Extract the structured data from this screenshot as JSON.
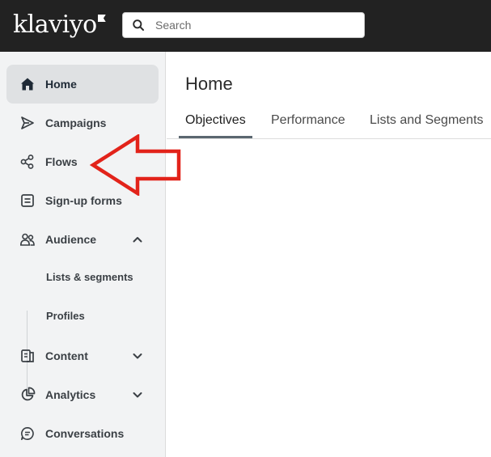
{
  "brand": {
    "logo_text": "klaviyo"
  },
  "search": {
    "placeholder": "Search"
  },
  "sidebar": {
    "items": [
      {
        "label": "Home",
        "icon": "home-icon"
      },
      {
        "label": "Campaigns",
        "icon": "send-icon"
      },
      {
        "label": "Flows",
        "icon": "flows-icon"
      },
      {
        "label": "Sign-up forms",
        "icon": "form-icon"
      },
      {
        "label": "Audience",
        "icon": "people-icon"
      },
      {
        "label": "Content",
        "icon": "content-icon"
      },
      {
        "label": "Analytics",
        "icon": "pie-chart-icon"
      },
      {
        "label": "Conversations",
        "icon": "chat-icon"
      }
    ],
    "audience_children": [
      {
        "label": "Lists & segments"
      },
      {
        "label": "Profiles"
      }
    ]
  },
  "main": {
    "title": "Home",
    "tabs": [
      {
        "label": "Objectives",
        "active": true
      },
      {
        "label": "Performance"
      },
      {
        "label": "Lists and Segments"
      }
    ]
  },
  "annotation": {
    "color": "#e2231a",
    "icon": "red-arrow-left-icon"
  },
  "colors": {
    "topbar": "#222222",
    "sidebar": "#f2f3f4",
    "active_item": "#dfe1e3"
  }
}
